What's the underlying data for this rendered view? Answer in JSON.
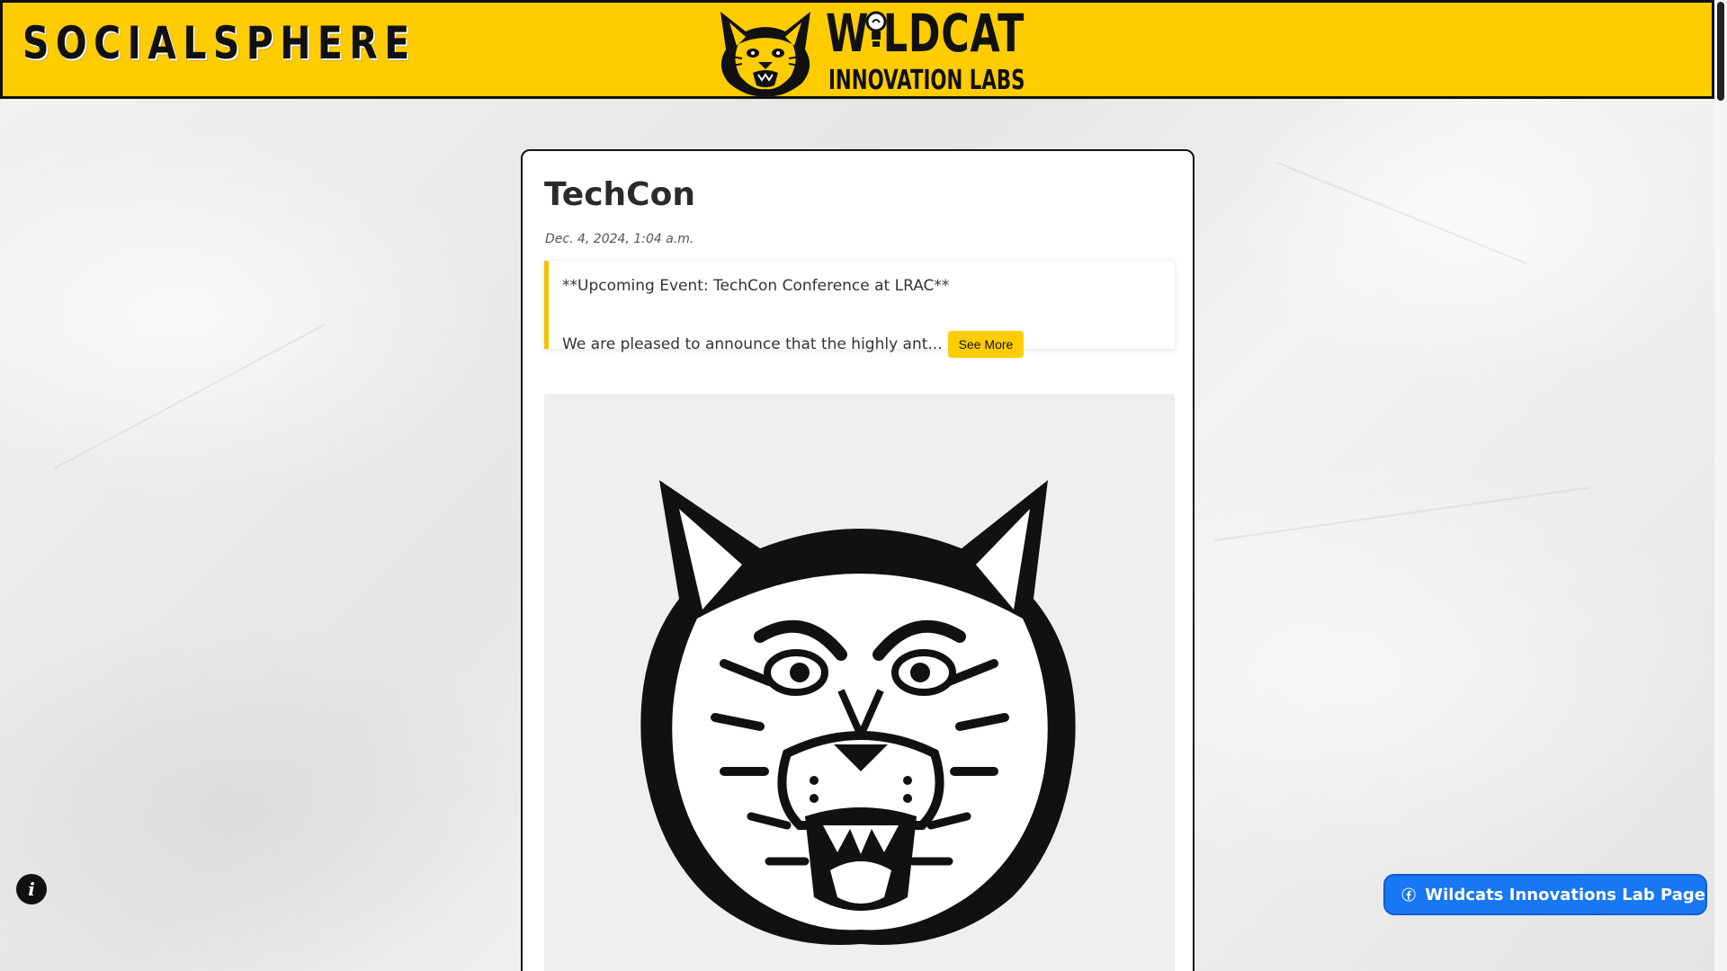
{
  "header": {
    "brand": "SOCIALSPHERE",
    "logo_title": "W LDCAT",
    "logo_subtitle": "INNOVATION LABS"
  },
  "post": {
    "title": "TechCon",
    "date": "Dec. 4, 2024, 1:04 a.m.",
    "headline": "**Upcoming Event: TechCon Conference at LRAC**",
    "excerpt": "We are pleased to announce that the highly ant...",
    "see_more_label": "See More",
    "image_icon": "wildcat-mascot"
  },
  "info_button": {
    "label": "i",
    "icon": "info-icon"
  },
  "facebook_button": {
    "label": "Wildcats Innovations Lab Page",
    "icon": "facebook-icon"
  },
  "colors": {
    "header_bg": "#ffcc00",
    "accent": "#f5c400",
    "facebook_blue": "#1877f2"
  }
}
